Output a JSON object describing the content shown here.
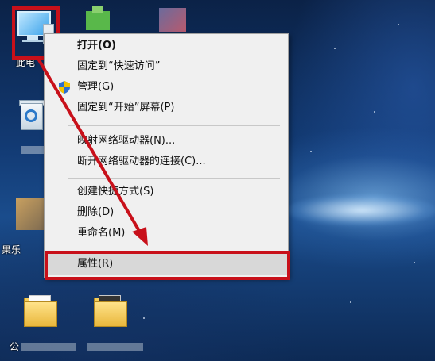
{
  "desktop": {
    "icons": {
      "pc_label": "此电",
      "recycle_label": "",
      "folder3_label": "果乐",
      "folder4_label": "公"
    }
  },
  "context_menu": {
    "items": [
      {
        "label": "打开(O)",
        "bold": true
      },
      {
        "label": "固定到“快速访问”"
      },
      {
        "label": "管理(G)",
        "icon": "uac-shield-icon"
      },
      {
        "label": "固定到“开始”屏幕(P)"
      },
      {
        "label": "映射网络驱动器(N)..."
      },
      {
        "label": "断开网络驱动器的连接(C)..."
      },
      {
        "label": "创建快捷方式(S)"
      },
      {
        "label": "删除(D)"
      },
      {
        "label": "重命名(M)"
      },
      {
        "label": "属性(R)",
        "selected": true
      }
    ]
  },
  "annotations": {
    "highlight_color": "#c8101a"
  }
}
